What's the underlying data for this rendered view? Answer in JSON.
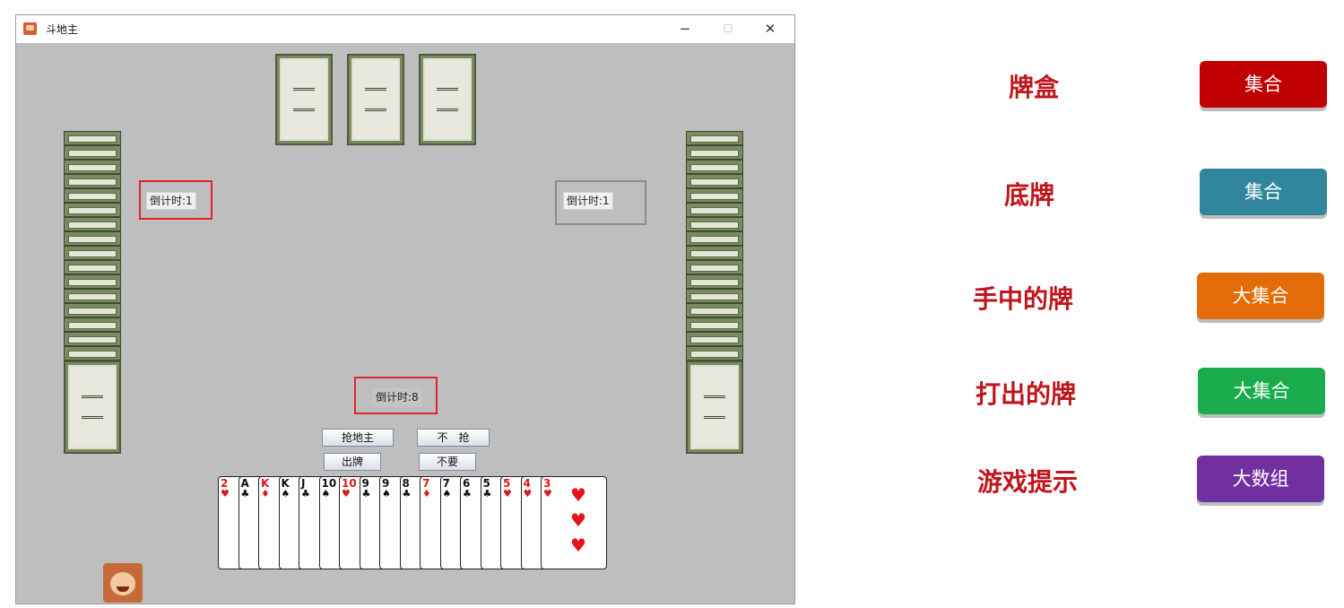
{
  "window": {
    "title": "斗地主",
    "min_glyph": "−",
    "max_glyph": "☐",
    "close_glyph": "✕"
  },
  "timers": {
    "left": "倒计时:1",
    "right": "倒计时:1",
    "bottom": "倒计时:8"
  },
  "buttons": {
    "call_landlord": "抢地主",
    "no_call": "不　抢",
    "play": "出牌",
    "pass": "不要"
  },
  "hand": [
    {
      "rank": "2",
      "suit": "♥",
      "color": "red"
    },
    {
      "rank": "A",
      "suit": "♣",
      "color": "black"
    },
    {
      "rank": "K",
      "suit": "♦",
      "color": "red"
    },
    {
      "rank": "K",
      "suit": "♠",
      "color": "black"
    },
    {
      "rank": "J",
      "suit": "♣",
      "color": "black"
    },
    {
      "rank": "10",
      "suit": "♠",
      "color": "black"
    },
    {
      "rank": "10",
      "suit": "♥",
      "color": "red"
    },
    {
      "rank": "9",
      "suit": "♣",
      "color": "black"
    },
    {
      "rank": "9",
      "suit": "♠",
      "color": "black"
    },
    {
      "rank": "8",
      "suit": "♣",
      "color": "black"
    },
    {
      "rank": "7",
      "suit": "♦",
      "color": "red"
    },
    {
      "rank": "7",
      "suit": "♠",
      "color": "black"
    },
    {
      "rank": "6",
      "suit": "♣",
      "color": "black"
    },
    {
      "rank": "5",
      "suit": "♣",
      "color": "black"
    },
    {
      "rank": "5",
      "suit": "♥",
      "color": "red"
    },
    {
      "rank": "4",
      "suit": "♥",
      "color": "red"
    },
    {
      "rank": "3",
      "suit": "♥",
      "color": "red"
    }
  ],
  "legend": [
    {
      "label": "牌盒",
      "button": "集合",
      "color": "#c00000"
    },
    {
      "label": "底牌",
      "button": "集合",
      "color": "#31859c"
    },
    {
      "label": "手中的牌",
      "button": "大集合",
      "color": "#e36c09"
    },
    {
      "label": "打出的牌",
      "button": "大集合",
      "color": "#1aab4c"
    },
    {
      "label": "游戏提示",
      "button": "大数组",
      "color": "#7030a0"
    }
  ]
}
